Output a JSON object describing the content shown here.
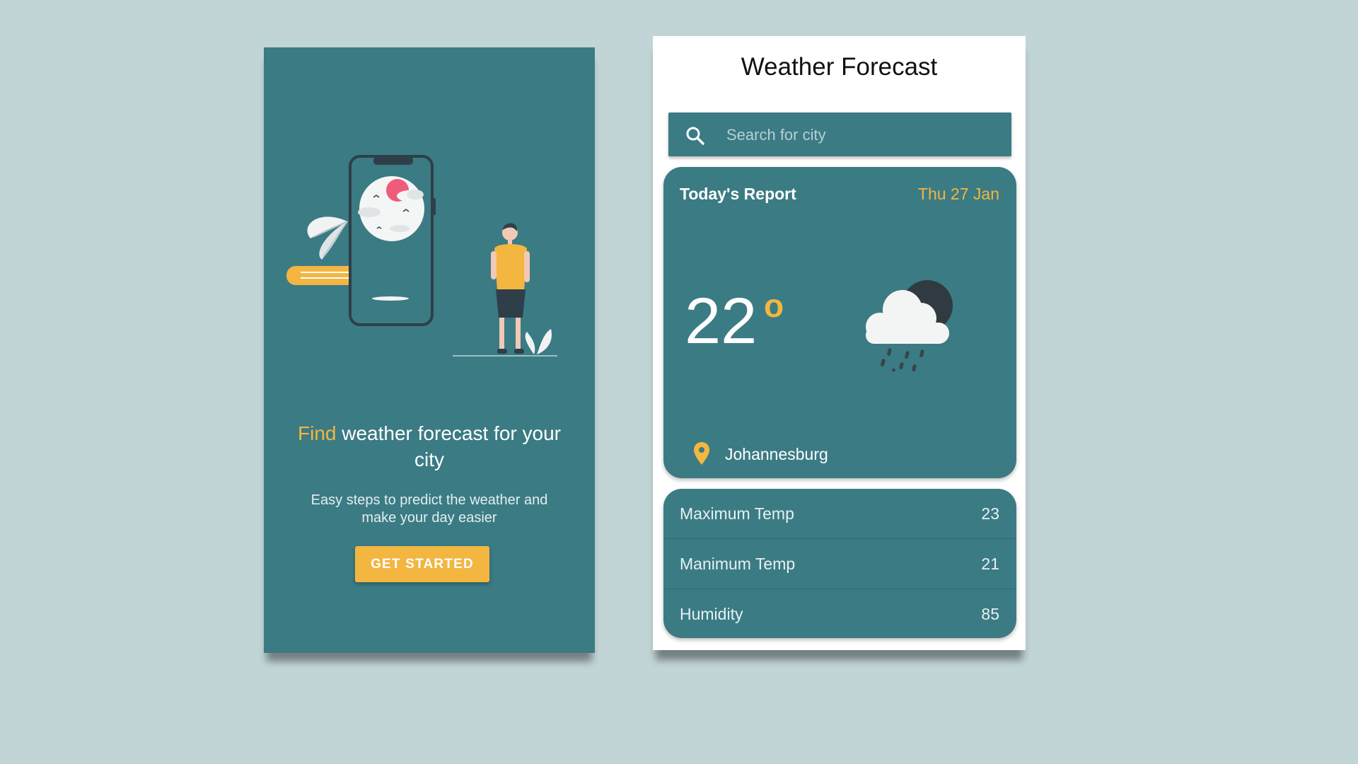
{
  "colors": {
    "background": "#c1d4d6",
    "teal": "#3b7b84",
    "accent": "#f3b640",
    "white": "#ffffff"
  },
  "onboarding": {
    "headline_accent": "Find",
    "headline_rest": " weather forecast for your city",
    "subtext": "Easy steps to predict the weather and make your day easier",
    "cta_label": "GET STARTED"
  },
  "forecast": {
    "title": "Weather Forecast",
    "search": {
      "placeholder": "Search for city",
      "icon": "search-icon"
    },
    "report": {
      "title": "Today's Report",
      "date": "Thu 27 Jan",
      "temperature": "22",
      "degree_symbol": "o",
      "condition_icon": "cloud-rain-night-icon",
      "location_icon": "location-pin-icon",
      "city": "Johannesburg"
    },
    "stats": [
      {
        "label": "Maximum Temp",
        "value": "23"
      },
      {
        "label": "Manimum Temp",
        "value": "21"
      },
      {
        "label": "Humidity",
        "value": "85"
      }
    ]
  }
}
